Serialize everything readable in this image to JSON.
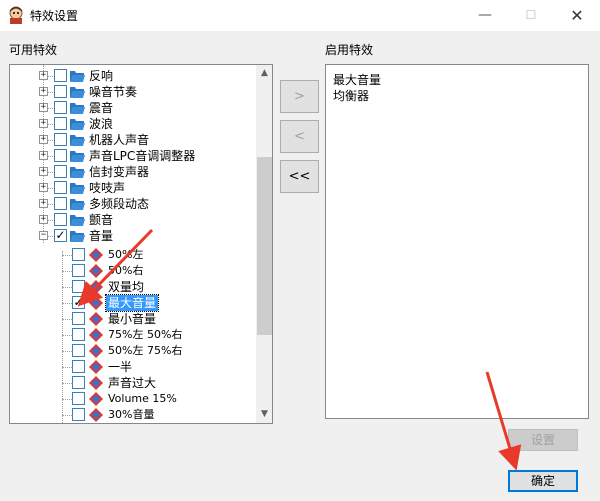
{
  "window": {
    "title": "特效设置",
    "minimize": "—",
    "maximize": "☐",
    "close": "✕"
  },
  "available": {
    "label": "可用特效",
    "folders": [
      "反响",
      "噪音节奏",
      "震音",
      "波浪",
      "机器人声音",
      "声音LPC音调调整器",
      "信封变声器",
      "吱吱声",
      "多频段动态",
      "颤音",
      "音量"
    ],
    "children": [
      {
        "label": "50%左",
        "checked": false
      },
      {
        "label": "50%右",
        "checked": false
      },
      {
        "label": "双量均",
        "checked": false
      },
      {
        "label": "最大音量",
        "checked": true,
        "selected": true
      },
      {
        "label": "最小音量",
        "checked": false
      },
      {
        "label": "75%左 50%右",
        "checked": false
      },
      {
        "label": "50%左 75%右",
        "checked": false
      },
      {
        "label": "一半",
        "checked": false
      },
      {
        "label": "声音过大",
        "checked": false
      },
      {
        "label": "Volume 15%",
        "checked": false
      },
      {
        "label": "30%音量",
        "checked": false
      }
    ],
    "check_mark": "✓",
    "scroll_up": "▲",
    "scroll_down": "▼"
  },
  "move_buttons": {
    "add": ">",
    "remove": "<",
    "remove_all": "<<"
  },
  "enabled": {
    "label": "启用特效",
    "items": [
      "最大音量",
      "均衡器"
    ]
  },
  "buttons": {
    "settings": "设置",
    "ok": "确定"
  },
  "colors": {
    "accent_selection": "#3399ff",
    "folder": "#2b79c2",
    "checkbox_border": "#3c7fb1",
    "arrow": "#e8392b",
    "fx_icon": "#d23b3b"
  },
  "icons": {
    "folder": "folder-open-icon",
    "effect": "effect-diamond-icon"
  }
}
